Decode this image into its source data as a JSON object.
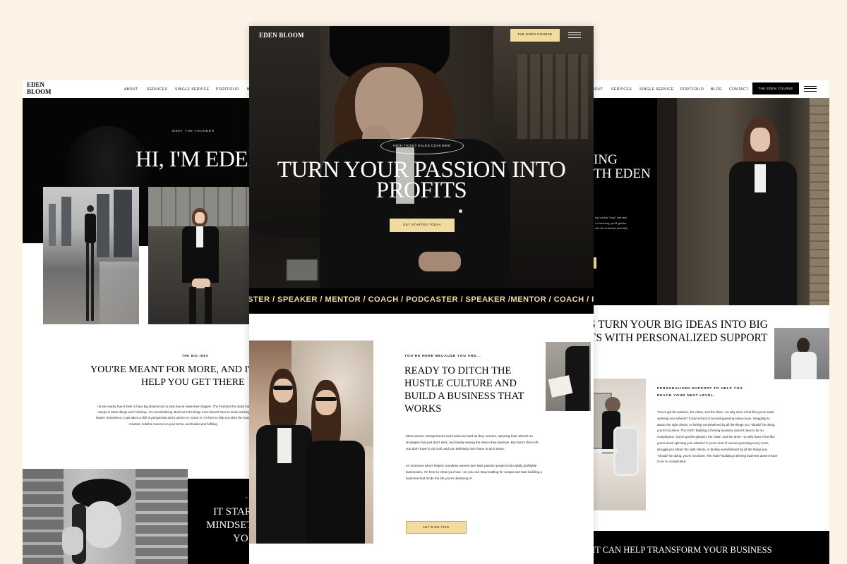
{
  "brand": {
    "logo": "EDEN BLOOM",
    "logo_line1": "EDEN",
    "logo_line2": "BLOOM"
  },
  "nav": {
    "about": "ABOUT",
    "services": "SERVICES",
    "single_service": "SINGLE SERVICE",
    "portfolio": "PORTFOLIO",
    "blog_cut": "BL",
    "blog": "BLOG",
    "contact": "CONTACT",
    "course_button": "THE EDEN COURSE"
  },
  "about_page": {
    "eyebrow": "MEET THE FOUNDER",
    "title": "HI, I'M EDEN",
    "big_idea_eyebrow": "THE BIG IDEA",
    "heading_line1": "YOU'RE MEANT FOR MORE, AND I'M",
    "heading_line2": "HELP YOU GET THERE",
    "body": "I know exactly how it feels to have big dreams but no idea how to make them happen. The frustratio the doubt that creeps in when things aren't clicking—it's overwhelming. But here's the thing: runni doesn't have to mean working harder. Sometimes, it just takes a shift in perspective and a partner w I come in. I'm here to help you ditch the hustle mindset, redefine success on your terms, and build a and fulfilling.",
    "bottom_eyebrow": "A",
    "bottom_heading_line1": "IT STAR",
    "bottom_heading_line2": "MINDSET,",
    "bottom_heading_line3": "YOU"
  },
  "home_page": {
    "badge": "HIGH TICKET SALES COACHING",
    "hero_line1": "TURN YOUR PASSION INTO",
    "hero_line2": "PROFITS",
    "cta": "GET STARTED TODAY",
    "ticker": "STER / SPEAKER / MENTOR / COACH / PODCASTER / SPEAKER /MENTOR / COACH / PODCAS",
    "eyebrow": "YOU'RE HERE BECAUSE YOU ARE...",
    "heading_line1": "READY TO DITCH THE",
    "heading_line2": "HUSTLE CULTURE AND",
    "heading_line3": "BUILD A BUSINESS THAT",
    "heading_line4": "WORKS",
    "para1": "Most women entrepreneurs work twice as hard as they need to, spinning their wheels on strategies that just don't stick, and barely seeing the return they deserve. But here's the truth: you don't have to do it all, and you definitely don't have to do it alone.",
    "para2": "As someone who's helped countless women turn their passion projects into wildly profitable businesses, I'm here to show you how—so you can stop hustling for scraps and start building a business that funds the life you're dreaming of.",
    "cta2": "LET'S DO THIS"
  },
  "service_page": {
    "hero_line1": "ING",
    "hero_line2": "TH EDEN",
    "hero_body_line1": "ing out the \"how\" can feel",
    "hero_body_line2": "s Coaching, you'll get the",
    "hero_body_line3": "uild the business (and life)",
    "heading_line1": "S TURN YOUR BIG IDEAS INTO BIG",
    "heading_line2": "TS WITH PERSONALIZED SUPPORT",
    "eyebrow_line1": "PERSONALIZED SUPPORT TO HELP YOU",
    "eyebrow_line2": "REACH YOUR NEXT LEVEL.",
    "body": "You've got the passion, the vision, and the drive—so why does it feel like you're stuck spinning your wheels? If you're tired of second-guessing every move, struggling to attract the right clients, or feeling overwhelmed by all the things you \"should\" be doing, you're not alone. The truth? Building a thriving business doesn't have to be so complicated. You've got the passion, the vision, and the drive—so why does it feel like you're stuck spinning your wheels? If you're tired of second-guessing every move, struggling to attract the right clients, or feeling overwhelmed by all the things you \"should\" be doing, you're not alone. The truth? Building a thriving business doesn't have to be so complicated.",
    "footer_heading": "IT CAN HELP TRANSFORM YOUR BUSINESS"
  },
  "colors": {
    "background": "#fcf3e6",
    "accent": "#f0dc9f",
    "black": "#000000"
  },
  "icons": {
    "menu": "hamburger-menu-icon"
  }
}
